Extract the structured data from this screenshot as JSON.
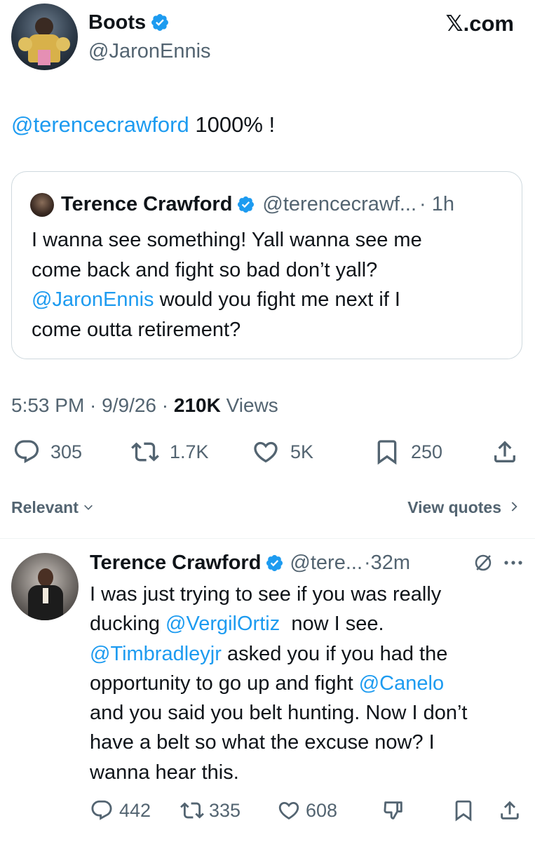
{
  "main_tweet": {
    "display_name": "Boots",
    "handle": "@JaronEnnis",
    "source_label": "𝕏.com",
    "text_mention": "@terencecrawford",
    "text_body": " 1000% !",
    "timestamp": "5:53 PM · 9/9/26 · ",
    "views_count": "210K",
    "views_label": " Views",
    "stats": {
      "replies": "305",
      "retweets": "1.7K",
      "likes": "5K",
      "bookmarks": "250"
    }
  },
  "quoted_tweet": {
    "display_name": "Terence Crawford",
    "handle": "@terencecrawf...",
    "time": "· 1h",
    "line1": "I wanna see something! Yall wanna see me",
    "line2": "come back and fight so bad don’t yall?",
    "mention": "@JaronEnnis",
    "line3_rest": " would you fight me next if I",
    "line4": "come outta retirement?"
  },
  "filter_bar": {
    "relevant_label": "Relevant",
    "view_quotes_label": "View quotes"
  },
  "reply": {
    "display_name": "Terence Crawford",
    "handle": "@tere...",
    "time": "·32m",
    "line1": "I was just trying to see if you was really",
    "line2_pre": "ducking ",
    "mention_vergil": "@VergilOrtiz",
    "line2_post": "  now I see.",
    "mention_tim": "@Timbradleyjr",
    "line3_rest": " asked you if you had the",
    "line4_pre": "opportunity to go up and fight ",
    "mention_canelo": "@Canelo",
    "line5": "and you said you belt hunting. Now I don’t",
    "line6": "have a belt so what the excuse now? I",
    "line7": "wanna hear this.",
    "stats": {
      "replies": "442",
      "retweets": "335",
      "likes": "608"
    }
  },
  "colors": {
    "accent": "#1d9bf0",
    "text": "#0f1419",
    "muted": "#536471",
    "border": "#cfd9de"
  }
}
